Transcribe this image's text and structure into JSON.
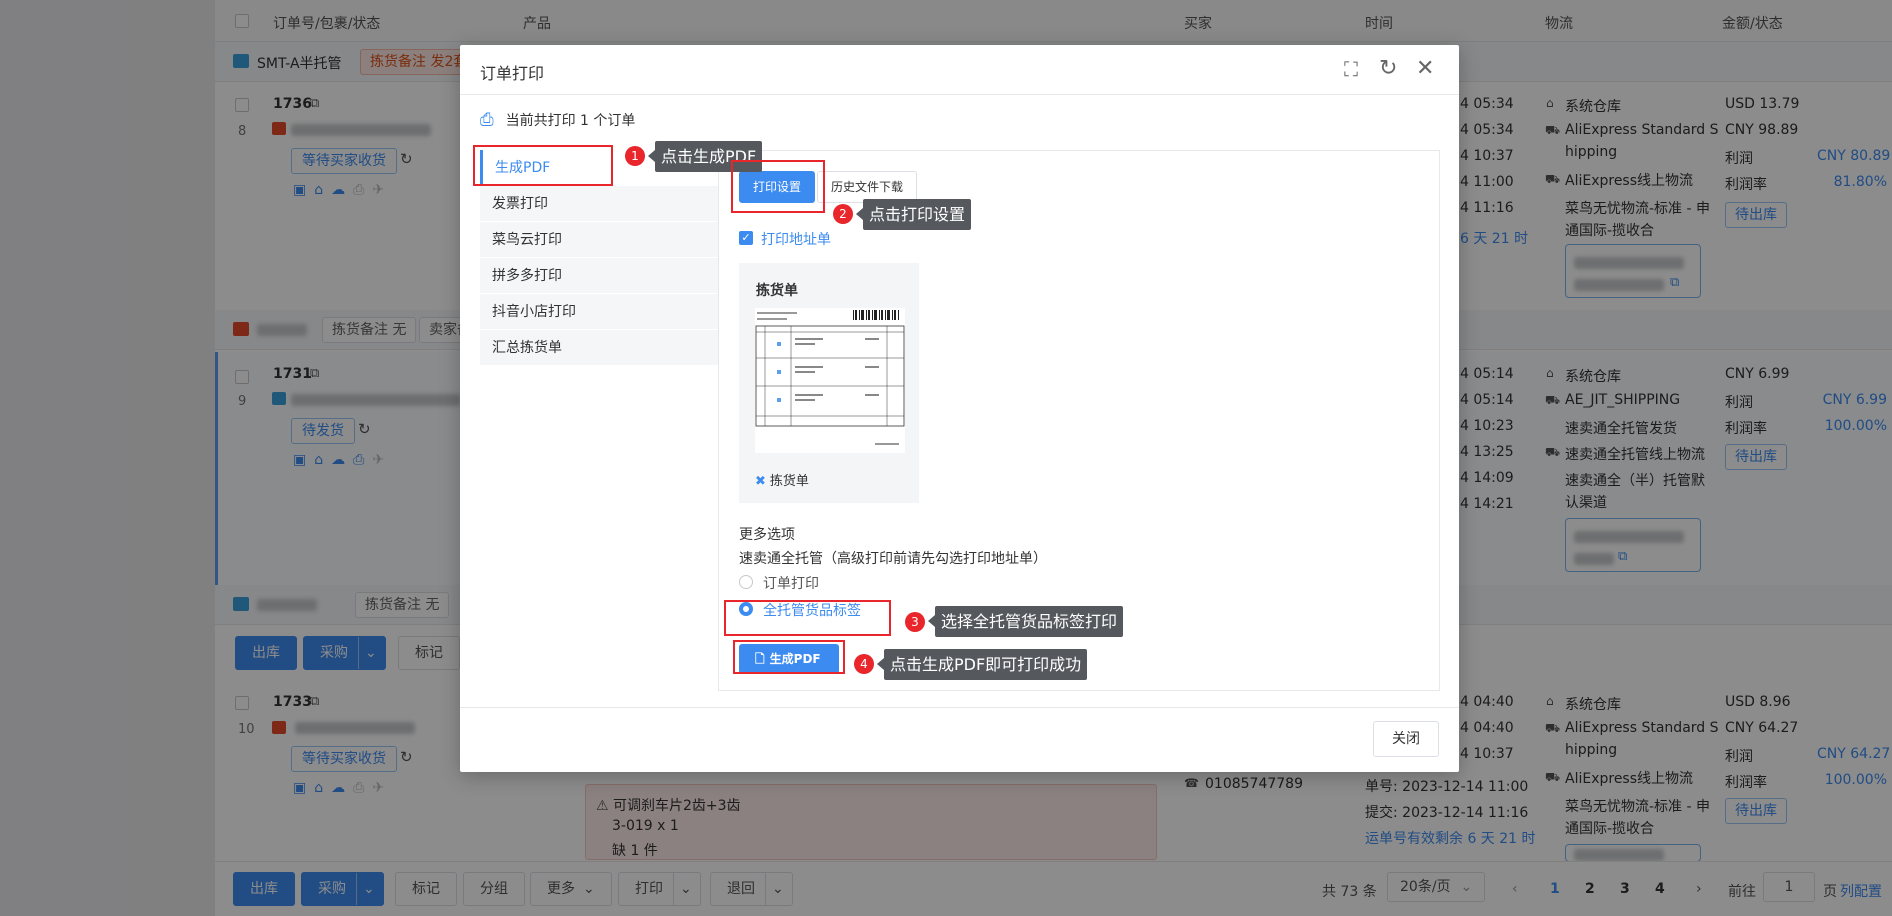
{
  "table_headers": [
    "订单号/包裹/状态",
    "产品",
    "买家",
    "时间",
    "物流",
    "金额/状态"
  ],
  "groups": [
    {
      "name": "SMT-A半托管",
      "tag": "拣货备注 发2套"
    },
    {
      "name": "",
      "tag1": "拣货备注 无",
      "tag2": "卖家备"
    },
    {
      "name": "",
      "tag1": "拣货备注 无"
    }
  ],
  "orders": [
    {
      "id": "1736",
      "index": "8",
      "status": "等待买家收货",
      "times": [
        "4 05:34",
        "4 05:34",
        "4 10:37",
        "4 11:00",
        "4 11:16"
      ],
      "time_remaining": "6 天 21 时",
      "logistics": [
        "系统仓库",
        "AliExpress Standard S",
        "hipping",
        "AliExpress线上物流",
        "菜鸟无忧物流-标准 - 申",
        "通国际-揽收合"
      ],
      "amount_usd": "USD 13.79",
      "amount_cny": "CNY 98.89",
      "profit_label": "利润",
      "profit": "CNY 80.89",
      "rate_label": "利润率",
      "rate": "81.80%",
      "out_label": "待出库"
    },
    {
      "id": "1731",
      "index": "9",
      "status": "待发货",
      "times": [
        "4 05:14",
        "4 05:14",
        "4 10:23",
        "4 13:25",
        "4 14:09",
        "4 14:21"
      ],
      "logistics": [
        "系统仓库",
        "AE_JIT_SHIPPING",
        "速卖通全托管发货",
        "速卖通全托管线上物流",
        "速卖通全（半）托管默",
        "认渠道"
      ],
      "amount_cny": "CNY 6.99",
      "profit_label": "利润",
      "profit": "CNY 6.99",
      "rate_label": "利润率",
      "rate": "100.00%",
      "out_label": "待出库"
    },
    {
      "id": "1733",
      "index": "10",
      "status": "等待买家收货",
      "times": [
        "4 04:40",
        "4 04:40",
        "4 10:37"
      ],
      "waybill": "单号: 2023-12-14 11:00",
      "submit": "提交: 2023-12-14 11:16",
      "waybill_valid": "运单号有效剩余 6 天 21 时",
      "phone": "01085747789",
      "warning_title": "可调刹车片2齿+3齿",
      "warning_sku": "3-019 x 1",
      "warning_short": "缺 1 件",
      "logistics": [
        "系统仓库",
        "AliExpress Standard S",
        "hipping",
        "AliExpress线上物流",
        "菜鸟无忧物流-标准 - 申",
        "通国际-揽收合"
      ],
      "amount_usd": "USD 8.96",
      "amount_cny": "CNY 64.27",
      "profit_label": "利润",
      "profit": "CNY 64.27",
      "rate_label": "利润率",
      "rate": "100.00%",
      "out_label": "待出库"
    }
  ],
  "mid_actions": {
    "outbound": "出库",
    "purchase": "采购",
    "mark": "标记"
  },
  "bottom_actions": {
    "outbound": "出库",
    "purchase": "采购",
    "mark": "标记",
    "group": "分组",
    "more": "更多",
    "print": "打印",
    "return": "退回"
  },
  "pagination": {
    "total": "共 73 条",
    "page_size": "20条/页",
    "pages": [
      "1",
      "2",
      "3",
      "4"
    ],
    "current": "1",
    "goto_label": "前往",
    "goto_value": "1",
    "page_unit": "页",
    "settings": "列配置"
  },
  "modal": {
    "title": "订单打印",
    "info": "当前共打印 1 个订单",
    "menu": [
      "生成PDF",
      "发票打印",
      "菜鸟云打印",
      "拼多多打印",
      "抖音小店打印",
      "汇总拣货单"
    ],
    "tabs": {
      "print_settings": "打印设置",
      "history": "历史文件下载"
    },
    "print_address_label": "打印地址单",
    "preview": {
      "title": "拣货单",
      "caption": "拣货单"
    },
    "more_options": "更多选项",
    "option_desc": "速卖通全托管（高级打印前请先勾选打印地址单）",
    "radio_order": "订单打印",
    "radio_label": "全托管货品标签",
    "generate_btn": "生成PDF",
    "close_btn": "关闭"
  },
  "callouts": [
    {
      "num": "1",
      "text": "点击生成PDF"
    },
    {
      "num": "2",
      "text": "点击打印设置"
    },
    {
      "num": "3",
      "text": "选择全托管货品标签打印"
    },
    {
      "num": "4",
      "text": "点击生成PDF即可打印成功"
    }
  ],
  "colors": {
    "accent": "#3c8bf0",
    "annotation_red": "#e8262b",
    "callout_bg": "#55595e",
    "overlay": "rgba(0,0,0,0.45)"
  }
}
